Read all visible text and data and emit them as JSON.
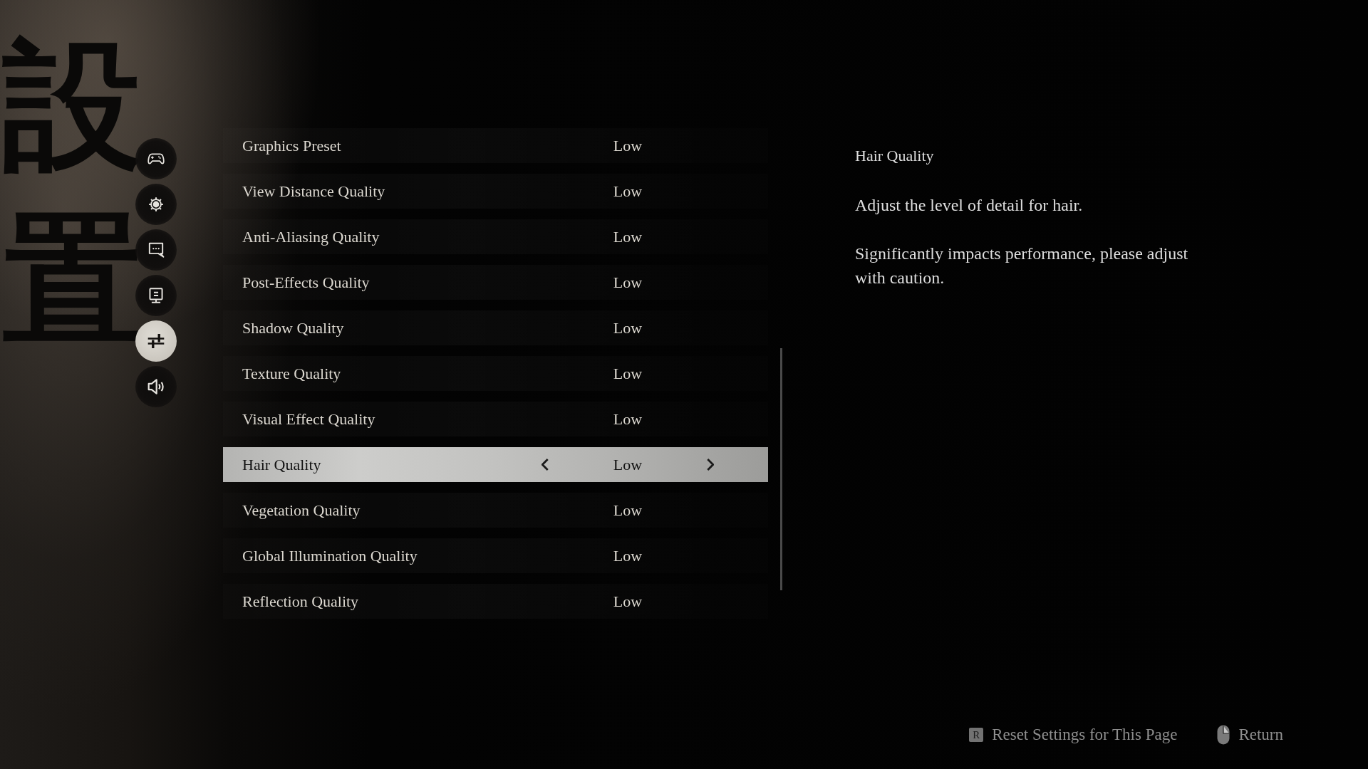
{
  "background": {
    "calligraphy": "設置"
  },
  "sidebar": {
    "items": [
      {
        "kind": "controls",
        "selected": false
      },
      {
        "kind": "general",
        "selected": false
      },
      {
        "kind": "language",
        "selected": false
      },
      {
        "kind": "display",
        "selected": false
      },
      {
        "kind": "graphics",
        "selected": true
      },
      {
        "kind": "audio",
        "selected": false
      }
    ]
  },
  "settings": {
    "rows": [
      {
        "label": "Graphics Preset",
        "value": "Low",
        "selected": false
      },
      {
        "label": "View Distance Quality",
        "value": "Low",
        "selected": false
      },
      {
        "label": "Anti-Aliasing Quality",
        "value": "Low",
        "selected": false
      },
      {
        "label": "Post-Effects Quality",
        "value": "Low",
        "selected": false
      },
      {
        "label": "Shadow Quality",
        "value": "Low",
        "selected": false
      },
      {
        "label": "Texture Quality",
        "value": "Low",
        "selected": false
      },
      {
        "label": "Visual Effect Quality",
        "value": "Low",
        "selected": false
      },
      {
        "label": "Hair Quality",
        "value": "Low",
        "selected": true
      },
      {
        "label": "Vegetation Quality",
        "value": "Low",
        "selected": false
      },
      {
        "label": "Global Illumination Quality",
        "value": "Low",
        "selected": false
      },
      {
        "label": "Reflection Quality",
        "value": "Low",
        "selected": false
      }
    ]
  },
  "details": {
    "title": "Hair Quality",
    "paragraphs": [
      "Adjust the level of detail for hair.",
      "Significantly impacts performance, please adjust with caution."
    ]
  },
  "footer": {
    "actions": [
      {
        "kind": "key",
        "key": "R",
        "label": "Reset Settings for This Page"
      },
      {
        "kind": "mouse",
        "label": "Return"
      }
    ]
  }
}
